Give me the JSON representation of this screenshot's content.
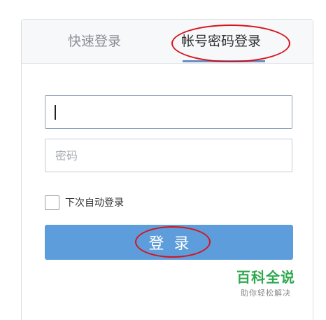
{
  "tabs": {
    "quick_login": "快速登录",
    "account_login": "帐号密码登录",
    "active": "account_login"
  },
  "form": {
    "username": {
      "value": "",
      "placeholder": ""
    },
    "password": {
      "value": "",
      "placeholder": "密码"
    },
    "remember_label": "下次自动登录",
    "remember_checked": false,
    "login_label": "登录"
  },
  "watermark": {
    "logo": "百科全说",
    "tagline": "助你轻松解决"
  },
  "colors": {
    "accent": "#5d9ddb",
    "tab_active": "#6b8fc4",
    "annotation": "#d6141c",
    "watermark": "#2fa84f"
  }
}
